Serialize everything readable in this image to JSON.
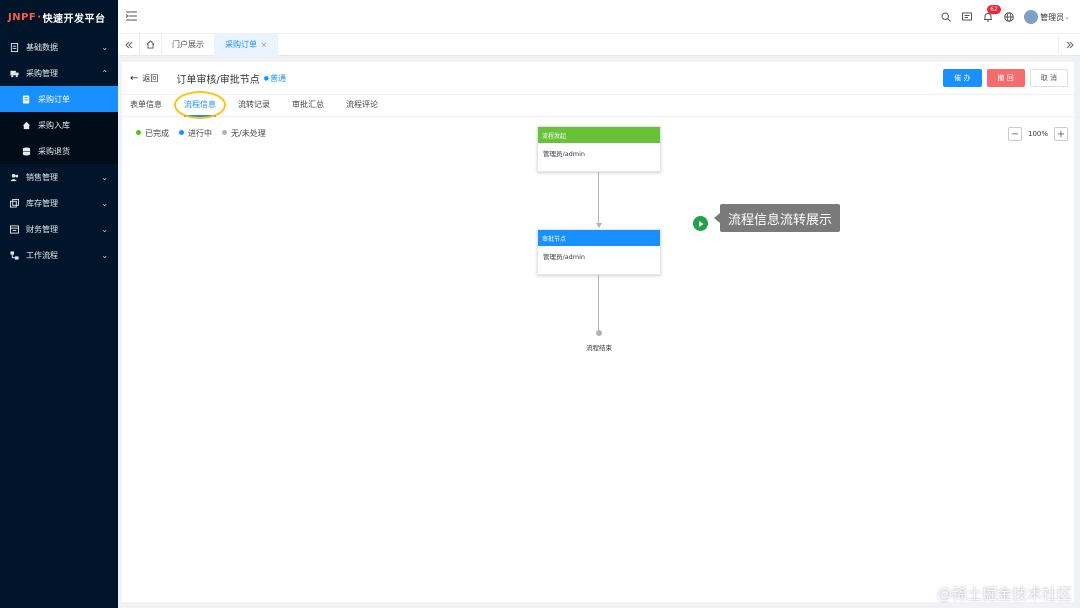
{
  "logo": {
    "mark": "JNPF",
    "sep": "·",
    "text": "快速开发平台"
  },
  "sidebar": {
    "items": [
      {
        "label": "基础数据",
        "icon": "document-icon",
        "chev": "⌄"
      },
      {
        "label": "采购管理",
        "icon": "truck-icon",
        "chev": "⌃"
      },
      {
        "label": "采购订单",
        "icon": "order-icon",
        "active": true
      },
      {
        "label": "采购入库",
        "icon": "home-icon"
      },
      {
        "label": "采购退货",
        "icon": "database-icon"
      },
      {
        "label": "销售管理",
        "icon": "users-icon",
        "chev": "⌄"
      },
      {
        "label": "库存管理",
        "icon": "stack-icon",
        "chev": "⌄"
      },
      {
        "label": "财务管理",
        "icon": "finance-icon",
        "chev": "⌄"
      },
      {
        "label": "工作流程",
        "icon": "workflow-icon",
        "chev": "⌄"
      }
    ]
  },
  "topbar": {
    "notification_count": "62",
    "user_name": "管理员",
    "user_chev": "⌄"
  },
  "tabs": [
    {
      "label": "门户展示"
    },
    {
      "label": "采购订单",
      "close": "×"
    }
  ],
  "header": {
    "back_label": "返回",
    "title": "订单审核/审批节点",
    "level": "普通",
    "btn_handle": "催 办",
    "btn_reject": "撤 回",
    "btn_cancel": "取 消"
  },
  "subtabs": [
    "表单信息",
    "流程信息",
    "流转记录",
    "审批汇总",
    "流程评论"
  ],
  "legend": [
    {
      "label": "已完成",
      "color": "#52c41a"
    },
    {
      "label": "进行中",
      "color": "#1890ff"
    },
    {
      "label": "无/未处理",
      "color": "#b0b4ba"
    }
  ],
  "zoom": {
    "value": "100%",
    "minus": "−",
    "plus": "+"
  },
  "flow": {
    "start": {
      "header": "流程发起",
      "body": "管理员/admin",
      "color": "#67c23a"
    },
    "approval": {
      "header": "审批节点",
      "body": "管理员/admin",
      "color": "#1890ff"
    },
    "end_label": "流程结束"
  },
  "callout": "流程信息流转展示",
  "watermark": "@稀土掘金技术社区"
}
